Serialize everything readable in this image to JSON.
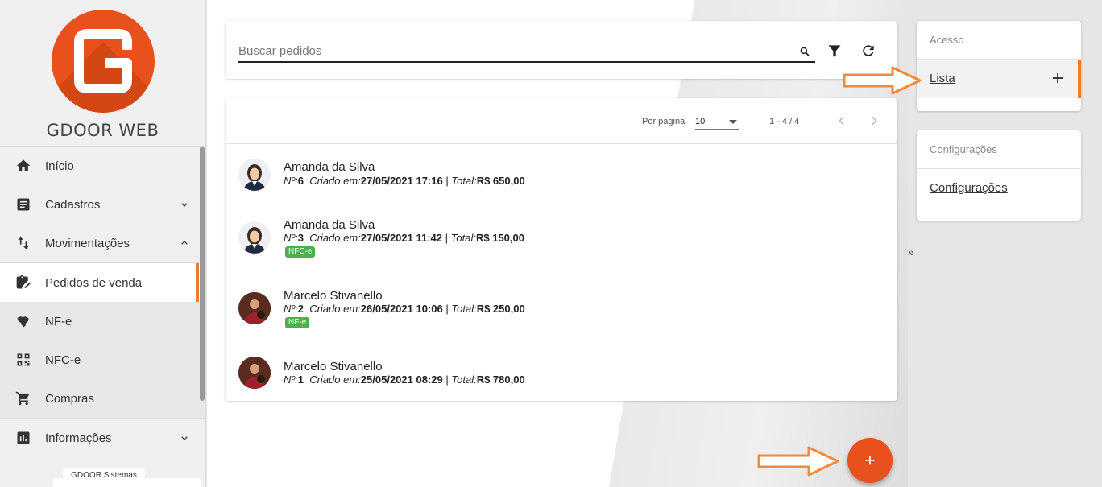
{
  "brand": {
    "name": "GDOOR WEB",
    "footer": "GDOOR Sistemas",
    "accent": "#e8501c",
    "active_indicator": "#f07a2e"
  },
  "sidebar": {
    "items": [
      {
        "label": "Início",
        "icon": "home-icon"
      },
      {
        "label": "Cadastros",
        "icon": "document-icon",
        "expander": "chevron-down"
      },
      {
        "label": "Movimentações",
        "icon": "swap-vertical-icon",
        "expander": "chevron-up"
      },
      {
        "label": "Pedidos de venda",
        "icon": "clipboard-edit-icon",
        "active": true
      },
      {
        "label": "NF-e",
        "icon": "brazil-map-icon"
      },
      {
        "label": "NFC-e",
        "icon": "qr-code-icon"
      },
      {
        "label": "Compras",
        "icon": "cart-icon"
      },
      {
        "label": "Informações",
        "icon": "bar-chart-icon",
        "expander": "chevron-down"
      }
    ]
  },
  "search": {
    "placeholder": "Buscar pedidos",
    "value": ""
  },
  "pager": {
    "per_page_label": "Por página",
    "per_page_value": "10",
    "range": "1 - 4 / 4"
  },
  "orders": [
    {
      "name": "Amanda da Silva",
      "num_label": "Nº:",
      "num": "6",
      "created_label": "Criado em:",
      "created": "27/05/2021 17:16",
      "sep": "|",
      "total_label": "Total:",
      "total": "R$ 650,00",
      "tag": ""
    },
    {
      "name": "Amanda da Silva",
      "num_label": "Nº:",
      "num": "3",
      "created_label": "Criado em:",
      "created": "27/05/2021 11:42",
      "sep": "|",
      "total_label": "Total:",
      "total": "R$ 150,00",
      "tag": "NFC-e"
    },
    {
      "name": "Marcelo Stivanello",
      "num_label": "Nº:",
      "num": "2",
      "created_label": "Criado em:",
      "created": "26/05/2021 10:06",
      "sep": "|",
      "total_label": "Total:",
      "total": "R$ 250,00",
      "tag": "NF-e"
    },
    {
      "name": "Marcelo Stivanello",
      "num_label": "Nº:",
      "num": "1",
      "created_label": "Criado em:",
      "created": "25/05/2021 08:29",
      "sep": "|",
      "total_label": "Total:",
      "total": "R$ 780,00",
      "tag": ""
    }
  ],
  "right_panel": {
    "toggle": "»",
    "access": {
      "header": "Acesso",
      "item": "Lista"
    },
    "config": {
      "header": "Configurações",
      "item": "Configurações"
    }
  },
  "fab": {
    "label": "+"
  }
}
